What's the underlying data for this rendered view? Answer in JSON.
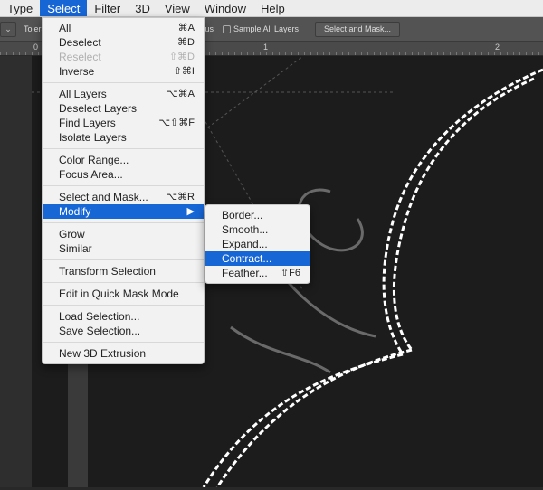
{
  "menubar": [
    "Type",
    "Select",
    "Filter",
    "3D",
    "View",
    "Window",
    "Help"
  ],
  "options": {
    "tolerance_label": "Tolerance",
    "contiguous_label": "Contiguous",
    "sample_all_layers": "Sample All Layers",
    "select_and_mask_button": "Select and Mask..."
  },
  "ruler": [
    "0",
    "1",
    "2"
  ],
  "select_menu": [
    [
      {
        "label": "All",
        "sc": "⌘A"
      },
      {
        "label": "Deselect",
        "sc": "⌘D"
      },
      {
        "label": "Reselect",
        "sc": "⇧⌘D",
        "disabled": true
      },
      {
        "label": "Inverse",
        "sc": "⇧⌘I"
      }
    ],
    [
      {
        "label": "All Layers",
        "sc": "⌥⌘A"
      },
      {
        "label": "Deselect Layers",
        "sc": ""
      },
      {
        "label": "Find Layers",
        "sc": "⌥⇧⌘F"
      },
      {
        "label": "Isolate Layers",
        "sc": ""
      }
    ],
    [
      {
        "label": "Color Range...",
        "sc": ""
      },
      {
        "label": "Focus Area...",
        "sc": ""
      }
    ],
    [
      {
        "label": "Select and Mask...",
        "sc": "⌥⌘R"
      },
      {
        "label": "Modify",
        "sc": "▶",
        "highlighted": true
      }
    ],
    [
      {
        "label": "Grow",
        "sc": ""
      },
      {
        "label": "Similar",
        "sc": ""
      }
    ],
    [
      {
        "label": "Transform Selection",
        "sc": ""
      }
    ],
    [
      {
        "label": "Edit in Quick Mask Mode",
        "sc": ""
      }
    ],
    [
      {
        "label": "Load Selection...",
        "sc": ""
      },
      {
        "label": "Save Selection...",
        "sc": ""
      }
    ],
    [
      {
        "label": "New 3D Extrusion",
        "sc": ""
      }
    ]
  ],
  "modify_menu": [
    {
      "label": "Border...",
      "sc": ""
    },
    {
      "label": "Smooth...",
      "sc": ""
    },
    {
      "label": "Expand...",
      "sc": ""
    },
    {
      "label": "Contract...",
      "sc": "",
      "highlighted": true
    },
    {
      "label": "Feather...",
      "sc": "⇧F6"
    }
  ],
  "colors": {
    "highlight": "#1766d6",
    "menu_bg": "#f2f2f2",
    "canvas": "#1c1c1c"
  }
}
